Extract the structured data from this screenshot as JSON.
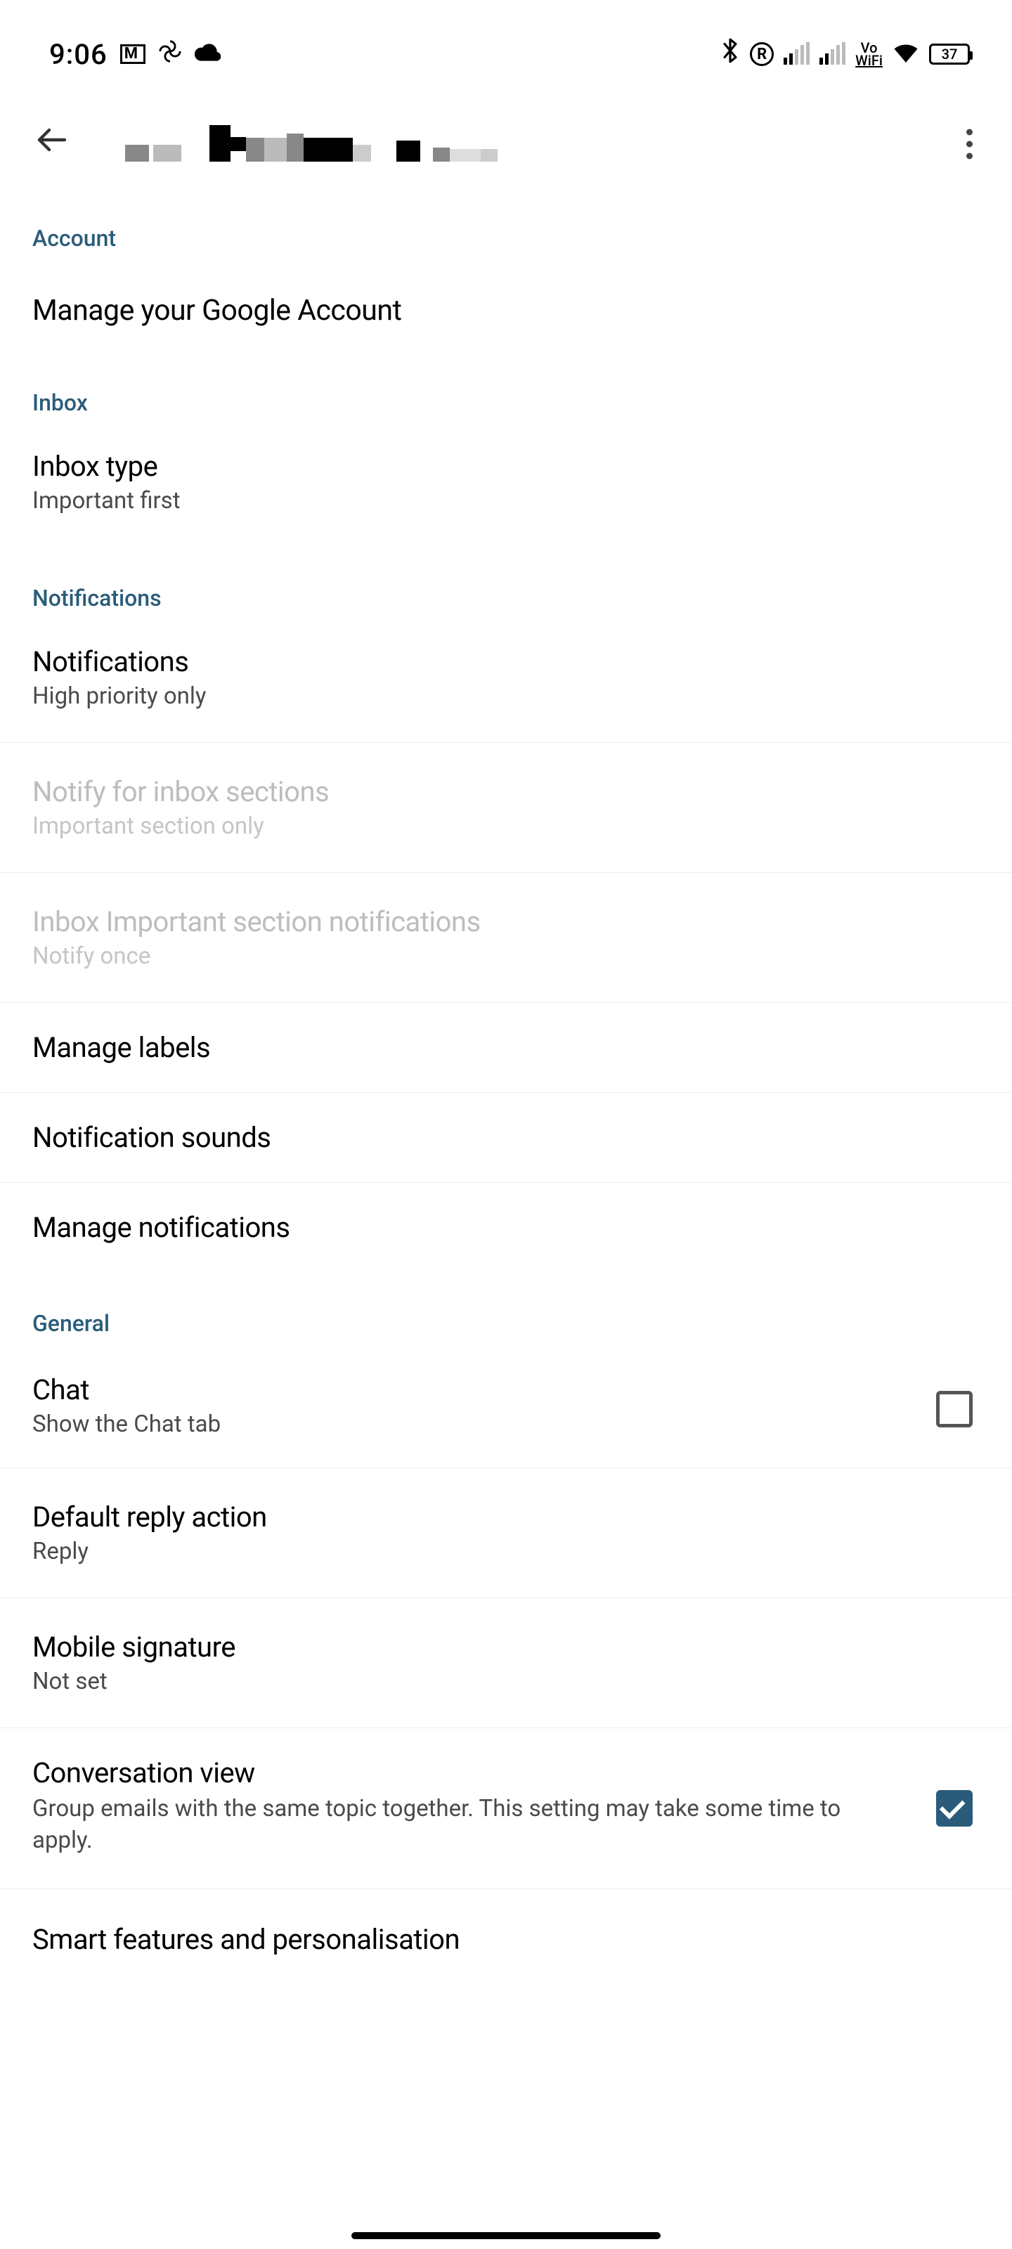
{
  "status": {
    "time": "9:06",
    "vowifi_top": "Vo",
    "vowifi_bottom": "WiFi",
    "battery_pct": "37"
  },
  "sections": {
    "account": {
      "header": "Account",
      "manage": "Manage your Google Account"
    },
    "inbox": {
      "header": "Inbox",
      "type_title": "Inbox type",
      "type_value": "Important first"
    },
    "notifications": {
      "header": "Notifications",
      "notif_title": "Notifications",
      "notif_value": "High priority only",
      "sections_title": "Notify for inbox sections",
      "sections_value": "Important section only",
      "important_title": "Inbox Important section notifications",
      "important_value": "Notify once",
      "labels": "Manage labels",
      "sounds": "Notification sounds",
      "manage_notifs": "Manage notifications"
    },
    "general": {
      "header": "General",
      "chat_title": "Chat",
      "chat_sub": "Show the Chat tab",
      "chat_checked": false,
      "reply_title": "Default reply action",
      "reply_value": "Reply",
      "sig_title": "Mobile signature",
      "sig_value": "Not set",
      "conv_title": "Conversation view",
      "conv_sub": "Group emails with the same topic together. This setting may take some time to apply.",
      "conv_checked": true,
      "smart_title": "Smart features and personalisation"
    }
  }
}
